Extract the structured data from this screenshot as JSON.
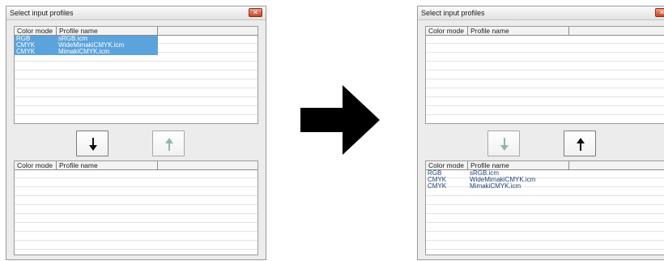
{
  "before_dialog": {
    "title": "Select input profiles",
    "top_table": {
      "headers": [
        "Color mode",
        "Profile name"
      ],
      "rows": [
        {
          "mode": "RGB",
          "name": "sRGB.icm",
          "selected": true
        },
        {
          "mode": "CMYK",
          "name": "WideMimakiCMYK.icm",
          "selected": true
        },
        {
          "mode": "CMYK",
          "name": "MimakiCMYK.icm",
          "selected": true
        }
      ]
    },
    "move_down_button": {
      "icon": "arrow-down-icon",
      "enabled": true
    },
    "move_up_button": {
      "icon": "arrow-up-icon",
      "enabled": false
    },
    "bottom_table": {
      "headers": [
        "Color mode",
        "Profile name"
      ],
      "rows": []
    }
  },
  "transition_arrow": {
    "icon": "arrow-right-icon"
  },
  "after_dialog": {
    "title": "Select input profiles",
    "top_table": {
      "headers": [
        "Color mode",
        "Profile name"
      ],
      "rows": []
    },
    "move_down_button": {
      "icon": "arrow-down-icon",
      "enabled": false
    },
    "move_up_button": {
      "icon": "arrow-up-icon",
      "enabled": true
    },
    "bottom_table": {
      "headers": [
        "Color mode",
        "Profile name"
      ],
      "rows": [
        {
          "mode": "RGB",
          "name": "sRGB.icm",
          "selected": false
        },
        {
          "mode": "CMYK",
          "name": "WideMimakiCMYK.icm",
          "selected": false
        },
        {
          "mode": "CMYK",
          "name": "MimakiCMYK.icm",
          "selected": false
        }
      ]
    }
  },
  "colors": {
    "selection": "#5ba3dc",
    "enabled_arrow": "#111111",
    "disabled_arrow": "#8fb8ad"
  }
}
